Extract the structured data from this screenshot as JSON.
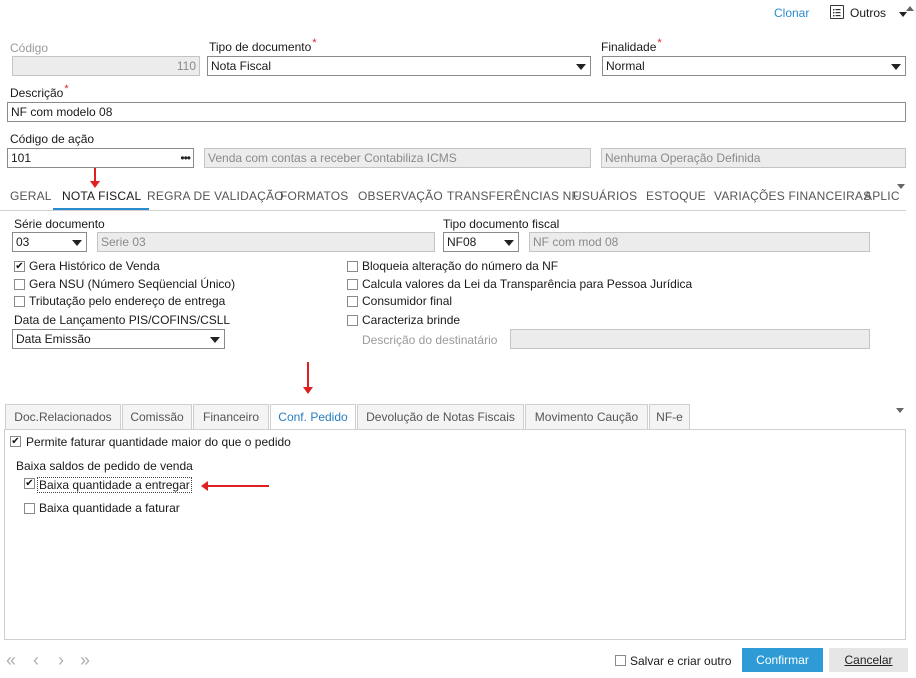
{
  "header": {
    "clear_label": "Clonar",
    "others_label": "Outros",
    "others_icon": "list-icon"
  },
  "form": {
    "codigo_label": "Código",
    "codigo_value": "110",
    "tipo_documento_label": "Tipo de documento",
    "tipo_documento_value": "Nota Fiscal",
    "finalidade_label": "Finalidade",
    "finalidade_value": "Normal",
    "descricao_label": "Descrição",
    "descricao_value": "NF com modelo 08",
    "codigo_acao_label": "Código de ação",
    "codigo_acao_value": "101",
    "codigo_acao_desc": "Venda com contas a receber Contabiliza ICMS",
    "operacao_value": "Nenhuma Operação Definida"
  },
  "main_tabs": [
    "GERAL",
    "NOTA FISCAL",
    "REGRA DE VALIDAÇÃO",
    "FORMATOS",
    "OBSERVAÇÃO",
    "TRANSFERÊNCIAS NF",
    "USUÁRIOS",
    "ESTOQUE",
    "VARIAÇÕES FINANCEIRAS",
    "APLIC"
  ],
  "nota_fiscal": {
    "serie_label": "Série documento",
    "serie_value": "03",
    "serie_desc": "Serie 03",
    "tipo_fiscal_label": "Tipo documento fiscal",
    "tipo_fiscal_value": "NF08",
    "tipo_fiscal_desc": "NF com mod 08",
    "checks_left": [
      {
        "label": "Gera Histórico de Venda",
        "checked": true
      },
      {
        "label": "Gera NSU (Número Seqüencial Único)",
        "checked": false
      },
      {
        "label": "Tributação pelo endereço de entrega",
        "checked": false
      }
    ],
    "checks_right": [
      {
        "label": "Bloqueia alteração do número da NF",
        "checked": false
      },
      {
        "label": "Calcula valores da Lei da Transparência para Pessoa Jurídica",
        "checked": false
      },
      {
        "label": "Consumidor final",
        "checked": false
      },
      {
        "label": "Caracteriza brinde",
        "checked": false
      }
    ],
    "pis_label": "Data de Lançamento PIS/COFINS/CSLL",
    "pis_value": "Data Emissão",
    "destinatario_label": "Descrição do destinatário"
  },
  "sub_tabs": [
    "Doc.Relacionados",
    "Comissão",
    "Financeiro",
    "Conf. Pedido",
    "Devolução de Notas Fiscais",
    "Movimento Caução",
    "NF-e"
  ],
  "conf_pedido": {
    "permite_label": "Permite faturar quantidade maior do que o pedido",
    "permite_checked": true,
    "baixa_group_label": "Baixa saldos de pedido de venda",
    "baixa_entregar_label": "Baixa quantidade a entregar",
    "baixa_entregar_checked": true,
    "baixa_faturar_label": "Baixa quantidade a faturar",
    "baixa_faturar_checked": false
  },
  "footer": {
    "salvar_criar_label": "Salvar e criar outro",
    "confirmar_label": "Confirmar",
    "cancelar_label": "Cancelar",
    "nav_icons": [
      "first-page-icon",
      "prev-page-icon",
      "next-page-icon",
      "last-page-icon"
    ]
  },
  "colors": {
    "accent": "#2a8ccf",
    "primary_button": "#2e9bd6",
    "required": "#d9262c",
    "annotation_arrow": "#e02020"
  }
}
